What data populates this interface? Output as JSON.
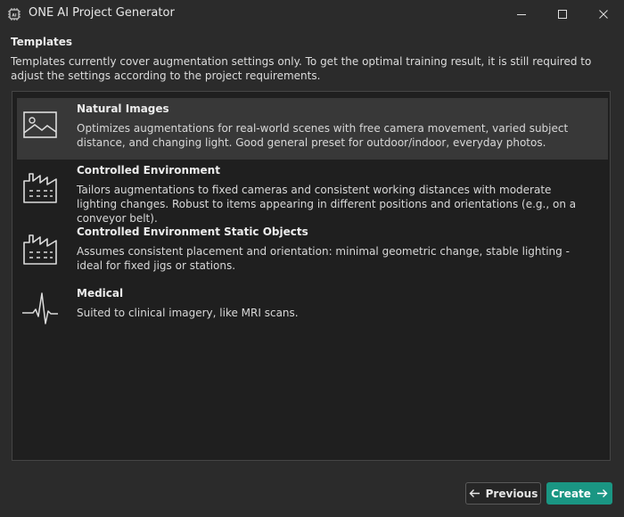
{
  "window": {
    "title": "ONE AI Project Generator",
    "icon": "app-chip-icon"
  },
  "templates_section": {
    "title": "Templates",
    "description": "Templates currently cover augmentation settings only. To get the optimal training result, it is still required to adjust the settings according to the project requirements."
  },
  "templates": [
    {
      "name": "Natural Images",
      "description": "Optimizes augmentations for real-world scenes with free camera movement, varied subject distance, and changing light. Good general preset for outdoor/indoor, everyday photos.",
      "icon": "image-icon",
      "selected": true
    },
    {
      "name": "Controlled Environment",
      "description": "Tailors augmentations to fixed cameras and consistent working distances with moderate lighting changes. Robust to items appearing in different positions and orientations (e.g., on a conveyor belt).",
      "icon": "factory-icon",
      "selected": false
    },
    {
      "name": "Controlled Environment Static Objects",
      "description": "Assumes consistent placement and orientation: minimal geometric change, stable lighting - ideal for fixed jigs or stations.",
      "icon": "factory-icon",
      "selected": false
    },
    {
      "name": "Medical",
      "description": "Suited to clinical imagery, like MRI scans.",
      "icon": "heartbeat-icon",
      "selected": false
    }
  ],
  "buttons": {
    "previous": "Previous",
    "create": "Create"
  },
  "colors": {
    "accent": "#1a9683",
    "background": "#2b2b2b",
    "panel": "#1f1f1f",
    "selected_row": "#383838"
  }
}
